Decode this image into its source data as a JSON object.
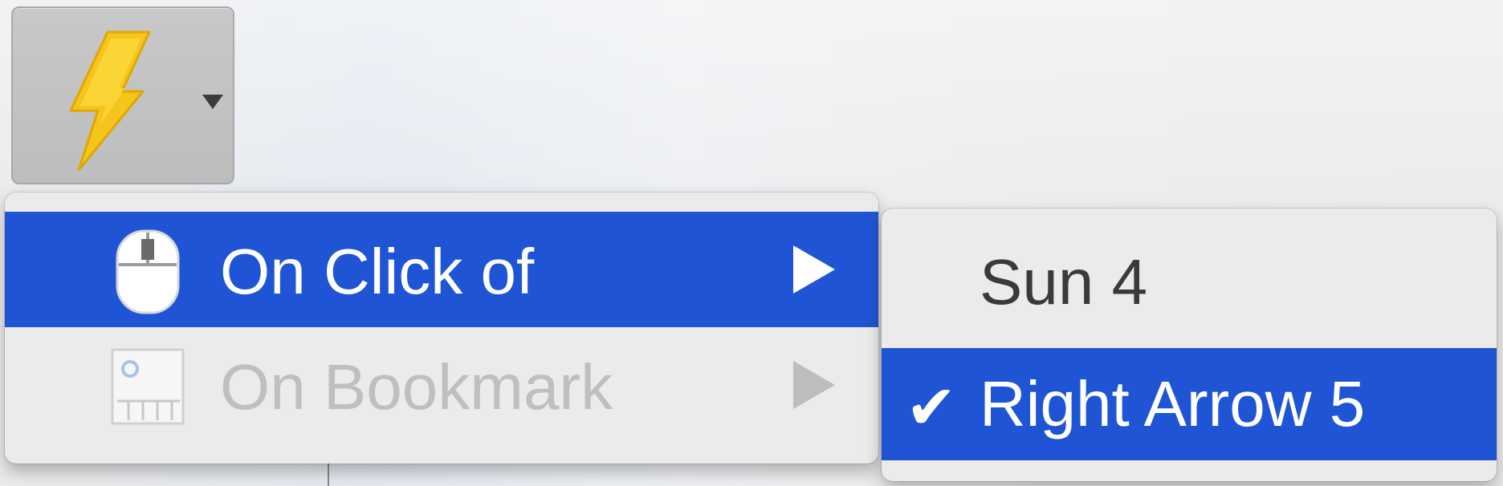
{
  "trigger": {
    "icon": "lightning-bolt-icon",
    "dropdown_icon": "triangle-down-icon"
  },
  "menu": {
    "items": [
      {
        "label": "On Click of",
        "icon": "mouse-icon",
        "state": "highlighted",
        "has_submenu": true
      },
      {
        "label": "On Bookmark",
        "icon": "bookmark-timeline-icon",
        "state": "disabled",
        "has_submenu": true
      }
    ]
  },
  "submenu": {
    "items": [
      {
        "label": "Sun 4",
        "checked": false
      },
      {
        "label": "Right Arrow 5",
        "checked": true,
        "check_glyph": "✔"
      }
    ]
  },
  "colors": {
    "highlight": "#1f55d4",
    "menu_background": "#ebebeb",
    "bolt_yellow": "#f5c518",
    "disabled_text": "#bfbfbf"
  }
}
